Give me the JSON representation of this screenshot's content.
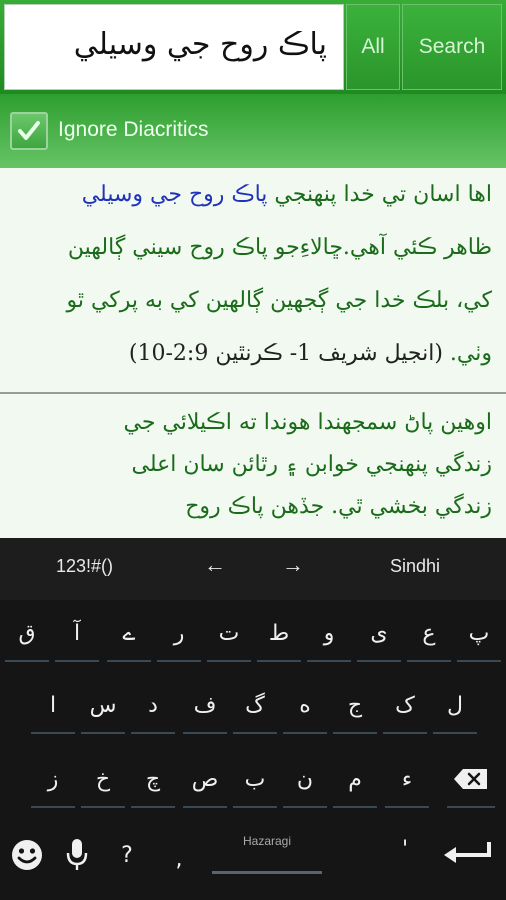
{
  "search": {
    "query": "پاڪ روح جي وسيلي",
    "all_label": "All",
    "search_label": "Search"
  },
  "options": {
    "ignore_diacritics_label": "Ignore Diacritics",
    "ignore_diacritics_checked": true
  },
  "results": [
    {
      "lines": [
        {
          "pre": "اها اسان تي خدا پنهنجي ",
          "hl": "پاڪ روح جي وسيلي",
          "post": ""
        },
        {
          "text": "ظاهر ڪئي آهي.ڇالاءِجو پاڪ روح سيني ڳالهين"
        },
        {
          "text": "کي، بلڪ خدا جي ڳجهين ڳالهين کي به پرکي ٿو"
        },
        {
          "text": "وٺي. ",
          "ref": "(انجيل شريف 1- ڪرنٿين 2:9-10)"
        }
      ]
    },
    {
      "lines": [
        {
          "text": "اوهين پاڻ سمجهندا هوندا ته اڪيلائي جي"
        },
        {
          "text": "زندگي پنهنجي خوابن ۽ رٿائن سان اعلى"
        },
        {
          "text": "زندگي بخشي ٿي. جڏهن پاڪ روح"
        }
      ]
    }
  ],
  "keyboard": {
    "mode_label": "123!#()",
    "left_arrow": "←",
    "right_arrow": "→",
    "language_label": "Sindhi",
    "row1": [
      "پ",
      "ع",
      "ی",
      "و",
      "ط",
      "ت",
      "ر",
      "ے",
      "آ",
      "ق"
    ],
    "row2": [
      "ل",
      "ک",
      "ج",
      "ه",
      "گ",
      "ف",
      "د",
      "س",
      "ا"
    ],
    "row3": [
      "ء",
      "م",
      "ن",
      "ب",
      "ص",
      "چ",
      "خ",
      "ز"
    ],
    "emoji_icon": "emoji-icon",
    "mic_icon": "mic-icon",
    "question": "?",
    "comma": ",",
    "space_label": "Hazaragi",
    "apostrophe": "'",
    "enter_icon": "enter-icon",
    "backspace_icon": "backspace-icon"
  },
  "colors": {
    "accent_green": "#2e9e2f",
    "highlight_blue": "#2233bb",
    "text_green": "#1b6b1b"
  }
}
